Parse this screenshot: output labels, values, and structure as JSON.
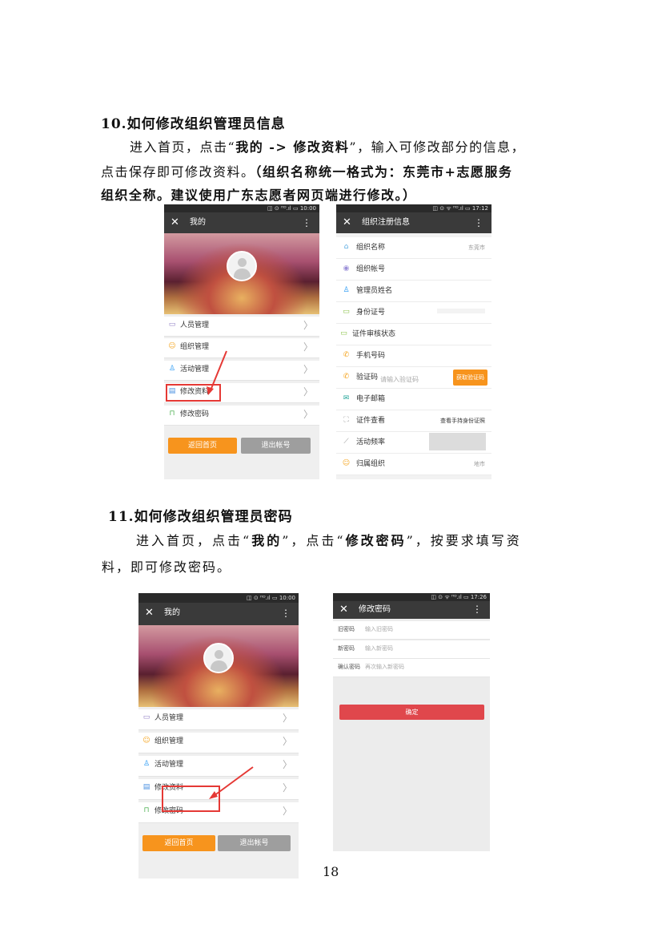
{
  "section10": {
    "heading": "10.如何修改组织管理员信息",
    "line1": "进入首页，点击“",
    "line1_bold": "我的 -> 修改资料",
    "line1_end": "”，输入可修改部分的信息，",
    "line2": "点击保存即可修改资料。",
    "line2_bold": "（组织名称统一格式为：东莞市+志愿服务",
    "line3_bold": "组织全称。建议使用广东志愿者网页端进行修改。）"
  },
  "section11": {
    "heading": "11.如何修改组织管理员密码",
    "line1_a": "进入首页，点击“",
    "line1_b": "我的",
    "line1_c": "”，点击“",
    "line1_d": "修改密码",
    "line1_e": "”，按要求填写资",
    "line2": "料，即可修改密码。"
  },
  "phone_me": {
    "status": "◫ ⊙ ᴴᴰ.ıl ▭ 10:00",
    "close": "✕",
    "title": "我的",
    "menu": "⋮",
    "items": [
      {
        "label": "人员管理",
        "icon": "id-card-icon"
      },
      {
        "label": "组织管理",
        "icon": "group-icon"
      },
      {
        "label": "活动管理",
        "icon": "person-icon"
      },
      {
        "label": "修改资料",
        "icon": "document-icon"
      },
      {
        "label": "修改密码",
        "icon": "lock-icon"
      }
    ],
    "chevron": "〉",
    "home_button": "返回首页",
    "logout_button": "退出帐号",
    "colors": {
      "home": "#f7941d",
      "logout": "#9e9e9e",
      "highlight": "#e53935"
    }
  },
  "phone_org": {
    "status": "◫ ⊙ ᯤ ᴴᴰ.ıl ▭ 17:12",
    "close": "✕",
    "title": "组织注册信息",
    "menu": "⋮",
    "fields": [
      {
        "label": "组织名称",
        "value": "东莞市"
      },
      {
        "label": "组织帐号",
        "value": ""
      },
      {
        "label": "管理员姓名",
        "value": ""
      },
      {
        "label": "身份证号",
        "value": ""
      },
      {
        "label": "证件审核状态",
        "value": ""
      },
      {
        "label": "手机号码",
        "value": ""
      },
      {
        "label": "验证码",
        "value": ""
      },
      {
        "label": "电子邮箱",
        "value": ""
      },
      {
        "label": "证件查看",
        "value": "查看手持身份证照"
      },
      {
        "label": "活动频率",
        "value": ""
      },
      {
        "label": "归属组织",
        "value": "地市"
      }
    ],
    "code_placeholder": "请输入验证码",
    "code_button": "获取验证码"
  },
  "phone_pw": {
    "status": "◫ ⊙ ᯤ ᴴᴰ.ıl ▭ 17:26",
    "close": "✕",
    "title": "修改密码",
    "menu": "⋮",
    "rows": [
      {
        "label": "旧密码",
        "placeholder": "输入旧密码"
      },
      {
        "label": "新密码",
        "placeholder": "输入新密码"
      },
      {
        "label": "确认密码",
        "placeholder": "再次输入新密码"
      }
    ],
    "confirm_button": "确定",
    "confirm_color": "#e0474c"
  },
  "page_number": "18"
}
